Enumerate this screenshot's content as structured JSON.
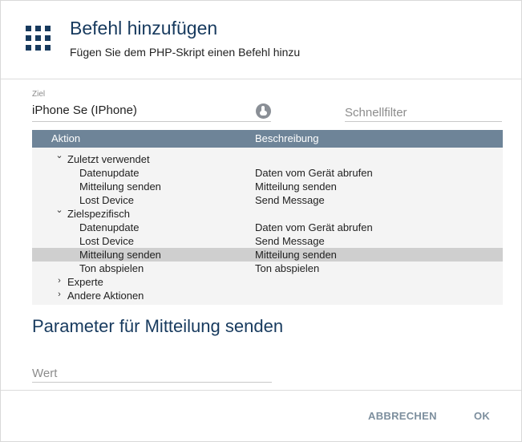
{
  "header": {
    "title": "Befehl hinzufügen",
    "subtitle": "Fügen Sie dem PHP-Skript einen Befehl hinzu",
    "icon": "apps-grid-icon"
  },
  "target": {
    "label": "Ziel",
    "value": "iPhone Se (IPhone)",
    "pick_icon": "pick-target-icon"
  },
  "filter": {
    "placeholder": "Schnellfilter"
  },
  "table": {
    "columns": [
      "Aktion",
      "Beschreibung"
    ],
    "rows": [
      {
        "type": "group",
        "label": "Zuletzt verwendet",
        "expanded": true,
        "desc": ""
      },
      {
        "type": "item",
        "label": "Datenupdate",
        "desc": "Daten vom Gerät abrufen"
      },
      {
        "type": "item",
        "label": "Mitteilung senden",
        "desc": "Mitteilung senden"
      },
      {
        "type": "item",
        "label": "Lost Device",
        "desc": "Send Message"
      },
      {
        "type": "group",
        "label": "Zielspezifisch",
        "expanded": true,
        "desc": ""
      },
      {
        "type": "item",
        "label": "Datenupdate",
        "desc": "Daten vom Gerät abrufen"
      },
      {
        "type": "item",
        "label": "Lost Device",
        "desc": "Send Message"
      },
      {
        "type": "item",
        "label": "Mitteilung senden",
        "desc": "Mitteilung senden",
        "selected": true
      },
      {
        "type": "item",
        "label": "Ton abspielen",
        "desc": "Ton abspielen"
      },
      {
        "type": "group",
        "label": "Experte",
        "expanded": false,
        "desc": ""
      },
      {
        "type": "group",
        "label": "Andere Aktionen",
        "expanded": false,
        "desc": ""
      }
    ]
  },
  "parameters": {
    "title": "Parameter für Mitteilung senden",
    "value_placeholder": "Wert"
  },
  "footer": {
    "cancel_label": "ABBRECHEN",
    "ok_label": "OK"
  },
  "colors": {
    "title": "#173a5e",
    "table_header": "#6e8498",
    "selected_row": "#cfcfcf",
    "button_text": "#7d8f9e"
  }
}
